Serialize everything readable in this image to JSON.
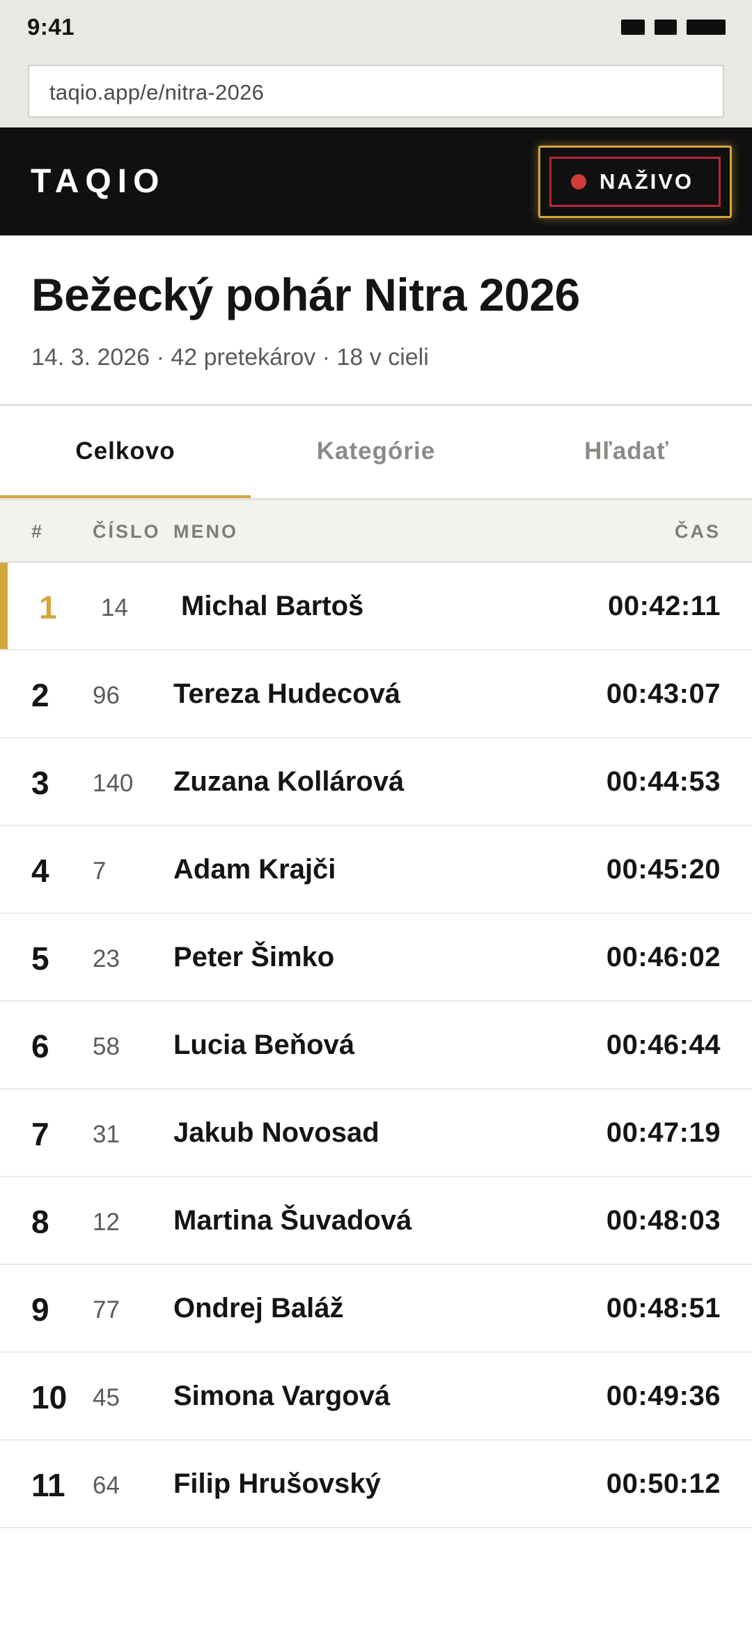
{
  "status_bar": {
    "time": "9:41"
  },
  "url_bar": {
    "url": "taqio.app/e/nitra-2026"
  },
  "header": {
    "logo": "TAQIO",
    "live_label": "NAŽIVO",
    "colors": {
      "accent": "#d4a63e",
      "live_dot": "#d33a3a",
      "background": "#0f100f"
    }
  },
  "event": {
    "title": "Bežecký pohár Nitra 2026",
    "subtitle": "14. 3. 2026 · 42 pretekárov · 18 v cieli"
  },
  "tabs": [
    {
      "label": "Celkovo",
      "active": true
    },
    {
      "label": "Kategórie",
      "active": false
    },
    {
      "label": "Hľadať",
      "active": false
    }
  ],
  "table": {
    "headers": {
      "rank": "#",
      "bib": "ČÍSLO",
      "name": "MENO",
      "time": "ČAS"
    },
    "rows": [
      {
        "rank": "1",
        "bib": "14",
        "name": "Michal Bartoš",
        "time": "00:42:11"
      },
      {
        "rank": "2",
        "bib": "96",
        "name": "Tereza Hudecová",
        "time": "00:43:07"
      },
      {
        "rank": "3",
        "bib": "140",
        "name": "Zuzana Kollárová",
        "time": "00:44:53"
      },
      {
        "rank": "4",
        "bib": "7",
        "name": "Adam Krajči",
        "time": "00:45:20"
      },
      {
        "rank": "5",
        "bib": "23",
        "name": "Peter Šimko",
        "time": "00:46:02"
      },
      {
        "rank": "6",
        "bib": "58",
        "name": "Lucia Beňová",
        "time": "00:46:44"
      },
      {
        "rank": "7",
        "bib": "31",
        "name": "Jakub Novosad",
        "time": "00:47:19"
      },
      {
        "rank": "8",
        "bib": "12",
        "name": "Martina Šuvadová",
        "time": "00:48:03"
      },
      {
        "rank": "9",
        "bib": "77",
        "name": "Ondrej Baláž",
        "time": "00:48:51"
      },
      {
        "rank": "10",
        "bib": "45",
        "name": "Simona Vargová",
        "time": "00:49:36"
      },
      {
        "rank": "11",
        "bib": "64",
        "name": "Filip Hrušovský",
        "time": "00:50:12"
      }
    ]
  }
}
